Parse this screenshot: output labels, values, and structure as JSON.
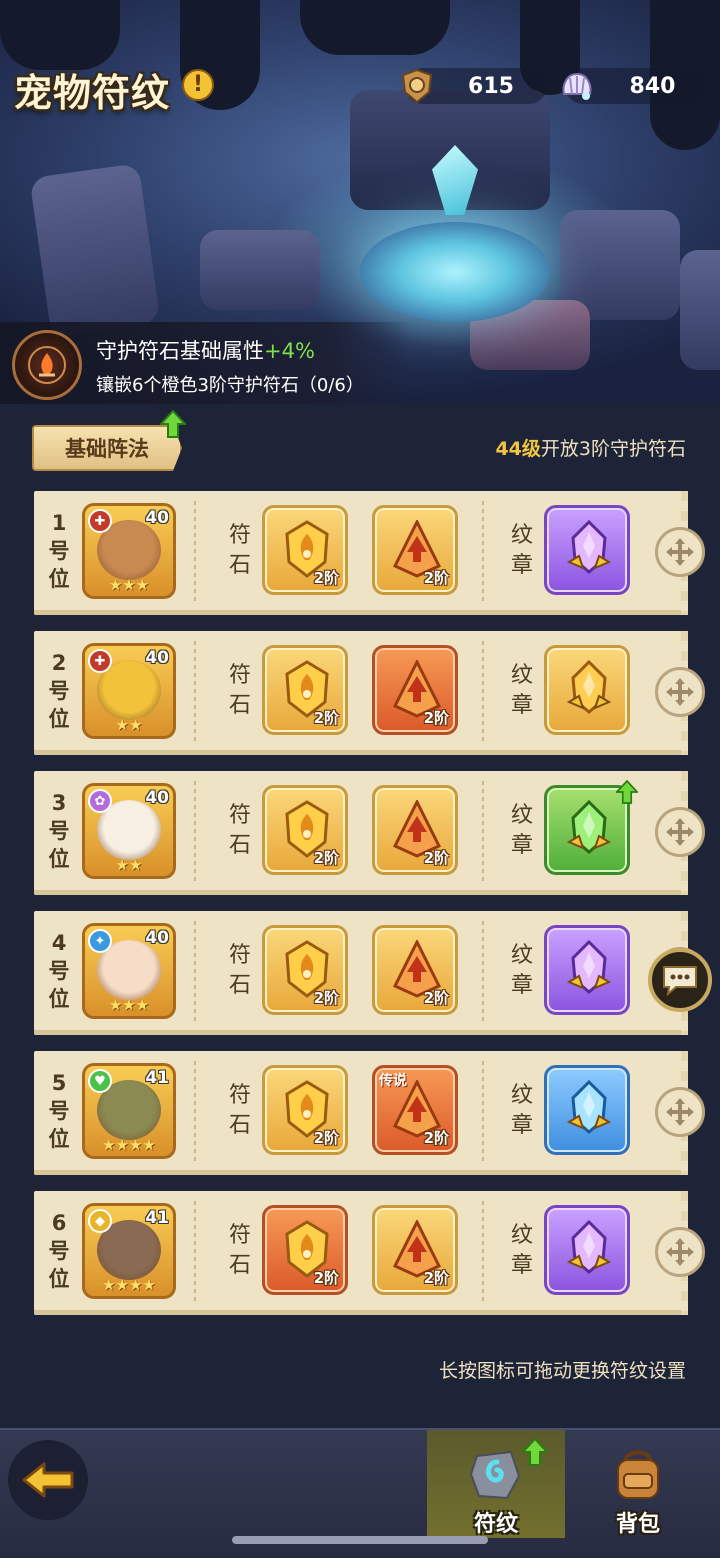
{
  "header": {
    "title": "宠物符纹",
    "info_icon": "exclamation-icon",
    "currencies": [
      {
        "icon": "shield-token-icon",
        "value": "615"
      },
      {
        "icon": "shell-icon",
        "value": "840"
      }
    ]
  },
  "bonus": {
    "line1": "守护符石基础属性",
    "plus": "+4%",
    "line2": "镶嵌6个橙色3阶守护符石（0/6）"
  },
  "formation": {
    "tab_label": "基础阵法",
    "unlock_level": "44级",
    "unlock_text": "开放3阶守护符石"
  },
  "labels": {
    "rune": "符石",
    "emblem": "纹章"
  },
  "slots": [
    {
      "pos": "1号位",
      "level": "40",
      "stars": "★★★",
      "rune1": {
        "tier": "2阶",
        "tag": ""
      },
      "rune2": {
        "tier": "2阶",
        "tag": ""
      }
    },
    {
      "pos": "2号位",
      "level": "40",
      "stars": "★★",
      "rune1": {
        "tier": "2阶",
        "tag": ""
      },
      "rune2": {
        "tier": "2阶",
        "tag": ""
      }
    },
    {
      "pos": "3号位",
      "level": "40",
      "stars": "★★",
      "rune1": {
        "tier": "2阶",
        "tag": ""
      },
      "rune2": {
        "tier": "2阶",
        "tag": ""
      }
    },
    {
      "pos": "4号位",
      "level": "40",
      "stars": "★★★",
      "rune1": {
        "tier": "2阶",
        "tag": ""
      },
      "rune2": {
        "tier": "2阶",
        "tag": ""
      }
    },
    {
      "pos": "5号位",
      "level": "41",
      "stars": "★★★★",
      "rune1": {
        "tier": "2阶",
        "tag": ""
      },
      "rune2": {
        "tier": "2阶",
        "tag": "传说"
      }
    },
    {
      "pos": "6号位",
      "level": "41",
      "stars": "★★★★",
      "rune1": {
        "tier": "2阶",
        "tag": ""
      },
      "rune2": {
        "tier": "2阶",
        "tag": ""
      }
    }
  ],
  "footer_hint": "长按图标可拖动更换符纹设置",
  "nav": {
    "runes": "符纹",
    "bag": "背包"
  },
  "colors": {
    "panel": "#efe3c6",
    "accent_gold": "#f2c541",
    "bonus_green": "#7fe04a",
    "background": "#1e2438"
  }
}
